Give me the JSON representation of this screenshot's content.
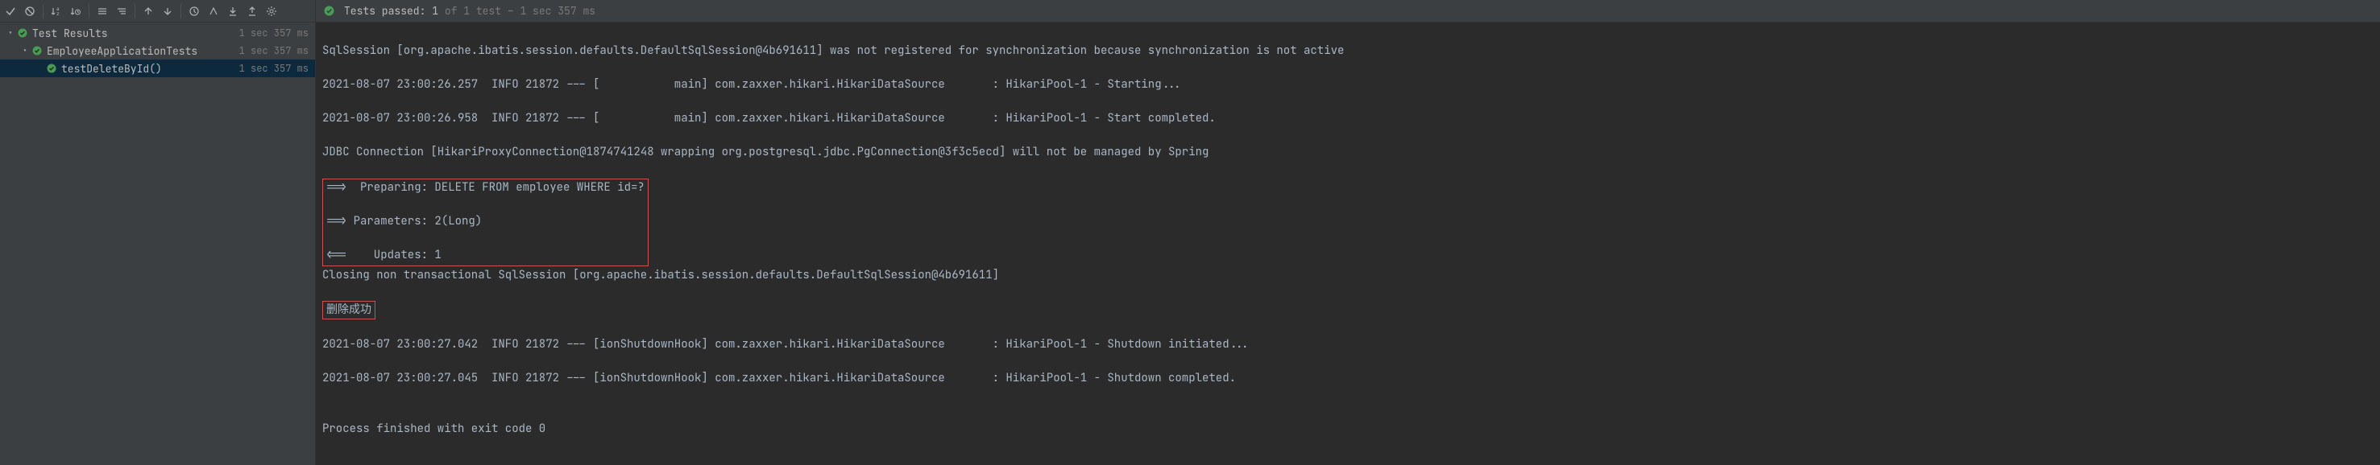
{
  "toolbar": {
    "icons": [
      "check",
      "stop",
      "sort-alpha",
      "sort-time",
      "expand",
      "collapse",
      "up",
      "down",
      "history",
      "filter",
      "import",
      "export",
      "settings"
    ]
  },
  "tree": {
    "root": {
      "label": "Test Results",
      "time": "1 sec 357 ms"
    },
    "child": {
      "label": "EmployeeApplicationTests",
      "time": "1 sec 357 ms"
    },
    "leaf": {
      "label": "testDeleteById()",
      "time": "1 sec 357 ms"
    }
  },
  "status": {
    "prefix": "Tests passed: ",
    "passed": "1",
    "of": " of 1 test",
    "dash": " – ",
    "duration": "1 sec 357 ms"
  },
  "console": {
    "l1": "SqlSession [org.apache.ibatis.session.defaults.DefaultSqlSession@4b691611] was not registered for synchronization because synchronization is not active",
    "l2": "2021-08-07 23:00:26.257  INFO 21872 --- [           main] com.zaxxer.hikari.HikariDataSource       : HikariPool-1 - Starting...",
    "l3": "2021-08-07 23:00:26.958  INFO 21872 --- [           main] com.zaxxer.hikari.HikariDataSource       : HikariPool-1 - Start completed.",
    "l4": "JDBC Connection [HikariProxyConnection@1874741248 wrapping org.postgresql.jdbc.PgConnection@3f3c5ecd] will not be managed by Spring",
    "l5": "==>  Preparing: DELETE FROM employee WHERE id=?",
    "l6": "==> Parameters: 2(Long)",
    "l7": "<==    Updates: 1",
    "l8": "Closing non transactional SqlSession [org.apache.ibatis.session.defaults.DefaultSqlSession@4b691611]",
    "l9": "删除成功",
    "l10": "2021-08-07 23:00:27.042  INFO 21872 --- [ionShutdownHook] com.zaxxer.hikari.HikariDataSource       : HikariPool-1 - Shutdown initiated...",
    "l11": "2021-08-07 23:00:27.045  INFO 21872 --- [ionShutdownHook] com.zaxxer.hikari.HikariDataSource       : HikariPool-1 - Shutdown completed.",
    "l12": "",
    "l13": "Process finished with exit code 0"
  }
}
